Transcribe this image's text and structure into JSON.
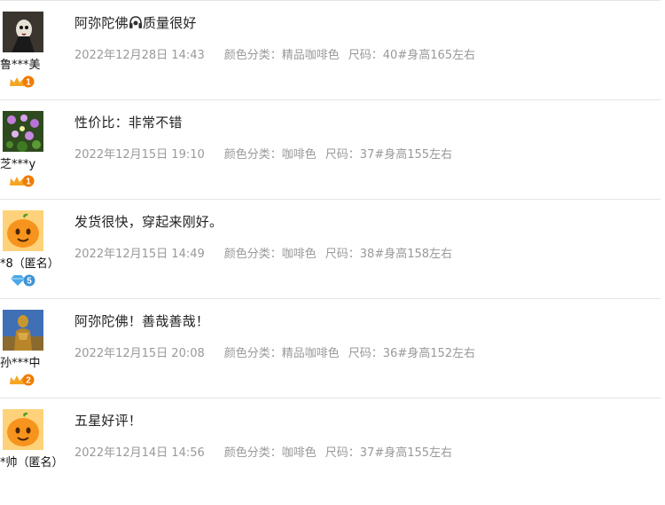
{
  "reviews": [
    {
      "username": "鲁***美",
      "avatar_icon": "masked-figure-avatar",
      "badge_icon": "crown-level-badge",
      "badge_level": "1",
      "content_before": "阿弥陀佛",
      "content_emoji": "headphones-emoji",
      "content_after": "质量很好",
      "date": "2022年12月28日 14:43",
      "color": "颜色分类：精品咖啡色",
      "size": "尺码：40#身高165左右"
    },
    {
      "username": "芝***y",
      "avatar_icon": "flowers-avatar",
      "badge_icon": "crown-level-badge",
      "badge_level": "1",
      "content": "性价比：非常不错",
      "date": "2022年12月15日 19:10",
      "color": "颜色分类：咖啡色",
      "size": "尺码：37#身高155左右"
    },
    {
      "username": "*8（匿名）",
      "avatar_icon": "anonymous-orange-avatar",
      "badge_icon": "diamond-level-badge",
      "badge_level": "5",
      "content": "发货很快，穿起来刚好。",
      "date": "2022年12月15日 14:49",
      "color": "颜色分类：咖啡色",
      "size": "尺码：38#身高158左右"
    },
    {
      "username": "孙***中",
      "avatar_icon": "buddha-statue-avatar",
      "badge_icon": "crown-level-badge",
      "badge_level": "2",
      "content": "阿弥陀佛！善哉善哉！",
      "date": "2022年12月15日 20:08",
      "color": "颜色分类：精品咖啡色",
      "size": "尺码：36#身高152左右"
    },
    {
      "username": "*帅（匿名）",
      "avatar_icon": "anonymous-orange-avatar",
      "content": "五星好评！",
      "date": "2022年12月14日 14:56",
      "color": "颜色分类：咖啡色",
      "size": "尺码：37#身高155左右"
    }
  ],
  "colors": {
    "crown": "#f5a623",
    "diamond": "#4aa8e8",
    "meta_text": "#999999",
    "content_text": "#222222",
    "divider": "#e4e4e4",
    "orange_avatar": "#f7941d"
  }
}
